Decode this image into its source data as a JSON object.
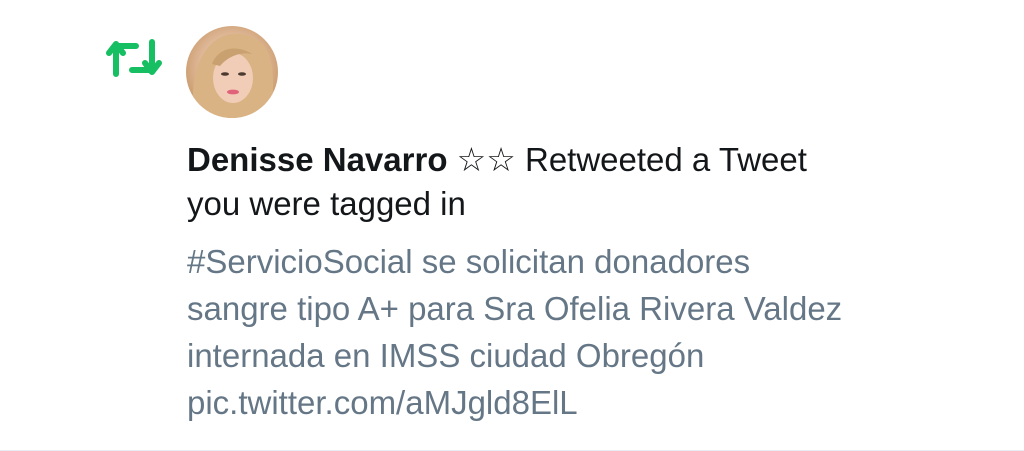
{
  "notification": {
    "type_icon": "retweet-icon",
    "accent_color": "#17bf63",
    "user_name": "Denisse Navarro",
    "user_badge": "☆☆",
    "action_line1": "Retweeted a Tweet",
    "action_line2": "you were tagged in",
    "tweet_lines": [
      "#ServicioSocial se solicitan donadores",
      "sangre tipo A+ para Sra Ofelia Rivera Valdez",
      "internada en IMSS ciudad Obregón",
      "pic.twitter.com/aMJgld8ElL"
    ]
  }
}
